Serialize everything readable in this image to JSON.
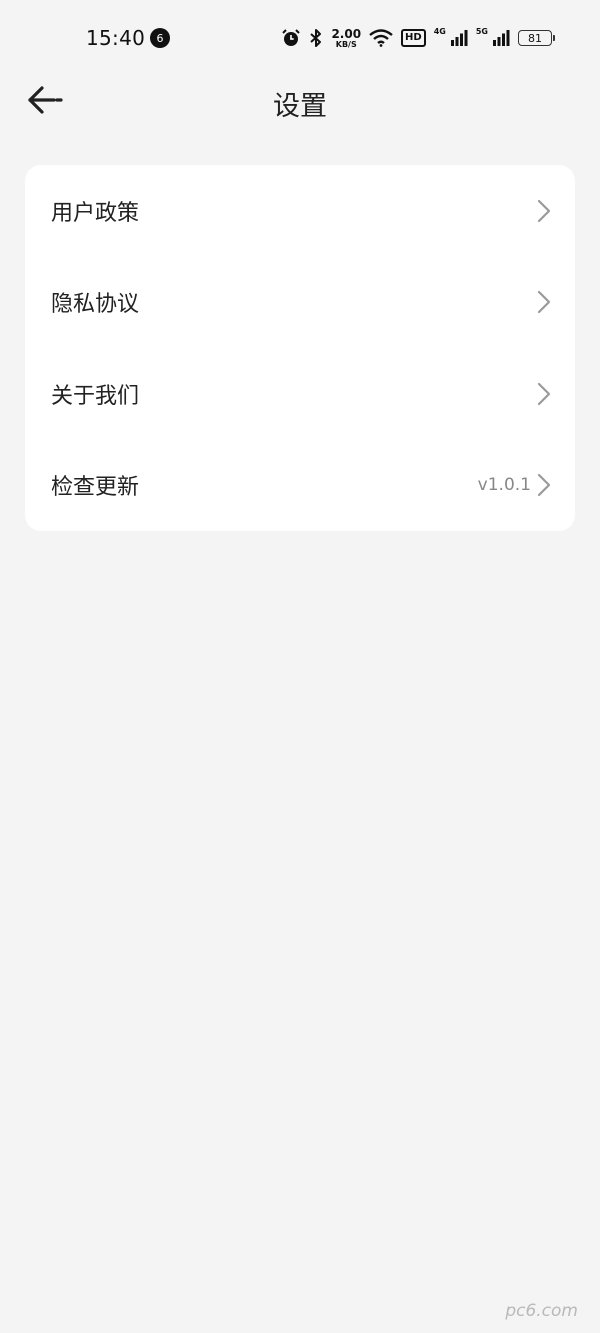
{
  "status_bar": {
    "time": "15:40",
    "notification_count": "6",
    "icons": [
      "alarm-icon",
      "bluetooth-icon",
      "wifi-icon",
      "signal-4g-icon",
      "signal-5g-icon"
    ],
    "net_speed_value": "2.00",
    "net_speed_unit": "KB/S",
    "hd_label": "HD",
    "network_4g": "4G",
    "network_5g": "5G",
    "battery": "81"
  },
  "header": {
    "title": "设置",
    "back_icon": "arrow-left-icon"
  },
  "settings": {
    "items": [
      {
        "label": "用户政策",
        "value": ""
      },
      {
        "label": "隐私协议",
        "value": ""
      },
      {
        "label": "关于我们",
        "value": ""
      },
      {
        "label": "检查更新",
        "value": "v1.0.1"
      }
    ],
    "chevron_icon": "chevron-right-icon"
  },
  "watermark": {
    "text": "pc6.com"
  },
  "colors": {
    "background": "#f4f4f4",
    "card": "#ffffff",
    "text": "#222222",
    "secondary_text": "#888888",
    "chevron": "#9a9a9a"
  }
}
